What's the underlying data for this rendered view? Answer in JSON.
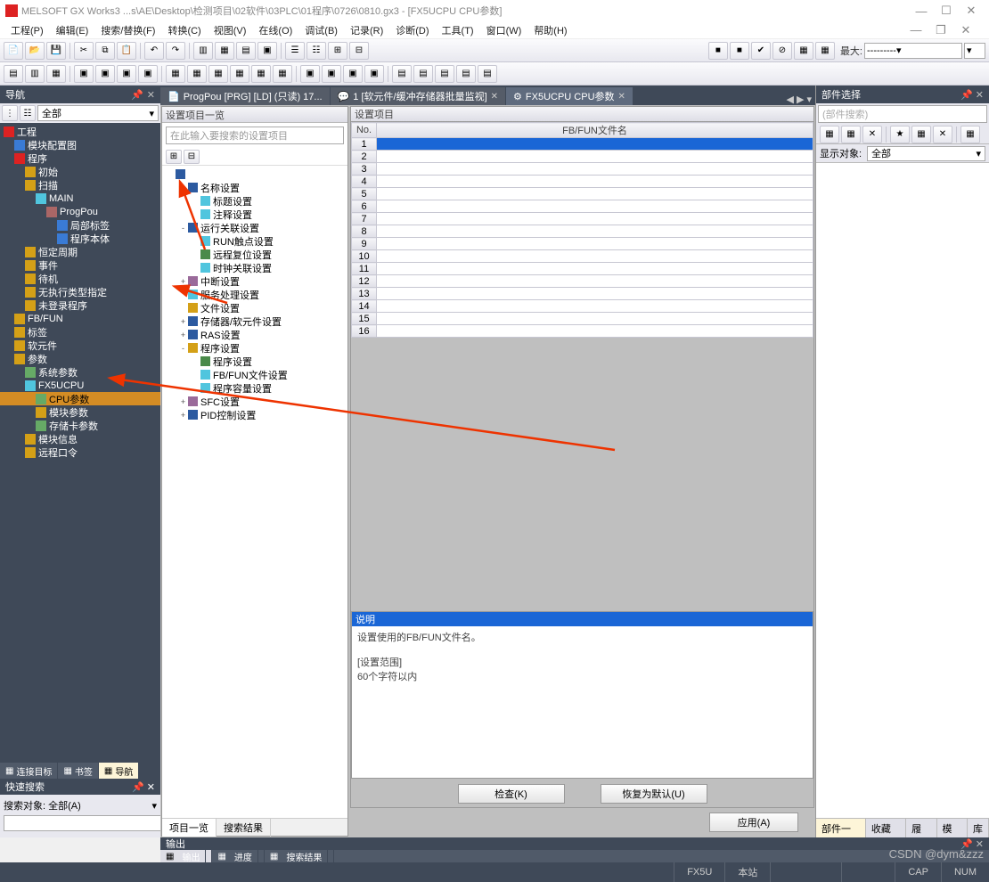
{
  "title": "MELSOFT GX Works3 ...s\\AE\\Desktop\\检测项目\\02软件\\03PLC\\01程序\\0726\\0810.gx3 - [FX5UCPU CPU参数]",
  "menu": [
    "工程(P)",
    "编辑(E)",
    "搜索/替换(F)",
    "转换(C)",
    "视图(V)",
    "在线(O)",
    "调试(B)",
    "记录(R)",
    "诊断(D)",
    "工具(T)",
    "窗口(W)",
    "帮助(H)"
  ],
  "tb2_label": "最大:",
  "tb2_combo": "---------",
  "left": {
    "title": "导航",
    "filter_label": "全部"
  },
  "nav_tree": [
    {
      "d": 0,
      "ic": "ico-red",
      "t": "工程"
    },
    {
      "d": 1,
      "ic": "ico-blue",
      "t": "模块配置图"
    },
    {
      "d": 1,
      "ic": "ico-red",
      "t": "程序"
    },
    {
      "d": 2,
      "ic": "ico-gold",
      "t": "初始"
    },
    {
      "d": 2,
      "ic": "ico-gold",
      "t": "扫描"
    },
    {
      "d": 3,
      "ic": "ico-cyan",
      "t": "MAIN"
    },
    {
      "d": 4,
      "ic": "ico-prog",
      "t": "ProgPou"
    },
    {
      "d": 5,
      "ic": "ico-blue",
      "t": "局部标签"
    },
    {
      "d": 5,
      "ic": "ico-blue",
      "t": "程序本体"
    },
    {
      "d": 2,
      "ic": "ico-gold",
      "t": "恒定周期"
    },
    {
      "d": 2,
      "ic": "ico-gold",
      "t": "事件"
    },
    {
      "d": 2,
      "ic": "ico-gold",
      "t": "待机"
    },
    {
      "d": 2,
      "ic": "ico-gold",
      "t": "无执行类型指定"
    },
    {
      "d": 2,
      "ic": "ico-gold",
      "t": "未登录程序"
    },
    {
      "d": 1,
      "ic": "ico-gold",
      "t": "FB/FUN"
    },
    {
      "d": 1,
      "ic": "ico-gold",
      "t": "标签"
    },
    {
      "d": 1,
      "ic": "ico-gold",
      "t": "软元件"
    },
    {
      "d": 1,
      "ic": "ico-gold",
      "t": "参数"
    },
    {
      "d": 2,
      "ic": "ico-green",
      "t": "系统参数"
    },
    {
      "d": 2,
      "ic": "ico-cyan",
      "t": "FX5UCPU"
    },
    {
      "d": 3,
      "ic": "ico-green",
      "t": "CPU参数",
      "sel": true
    },
    {
      "d": 3,
      "ic": "ico-gold",
      "t": "模块参数"
    },
    {
      "d": 3,
      "ic": "ico-green",
      "t": "存储卡参数"
    },
    {
      "d": 2,
      "ic": "ico-gold",
      "t": "模块信息"
    },
    {
      "d": 2,
      "ic": "ico-gold",
      "t": "远程口令"
    }
  ],
  "left_foot": [
    "连接目标",
    "书签",
    "导航"
  ],
  "quick": {
    "title": "快速搜索",
    "filter": "搜索对象: 全部(A)"
  },
  "doc_tabs": [
    {
      "label": "ProgPou [PRG] [LD] (只读) 17..."
    },
    {
      "label": "1 [软元件/缓冲存储器批量监视]"
    },
    {
      "label": "FX5UCPU CPU参数",
      "active": true
    }
  ],
  "setting": {
    "title_left": "设置项目一览",
    "title_right": "设置项目",
    "search_ph": "在此输入要搜索的设置项目",
    "tabs": [
      "项目一览",
      "搜索结果"
    ]
  },
  "stree": [
    {
      "d": 0,
      "tw": "",
      "ic": "si-b",
      "t": ""
    },
    {
      "d": 1,
      "tw": "-",
      "ic": "si-b",
      "t": "名称设置"
    },
    {
      "d": 2,
      "tw": "",
      "ic": "si-c",
      "t": "标题设置"
    },
    {
      "d": 2,
      "tw": "",
      "ic": "si-c",
      "t": "注释设置"
    },
    {
      "d": 1,
      "tw": "-",
      "ic": "si-b",
      "t": "运行关联设置"
    },
    {
      "d": 2,
      "tw": "",
      "ic": "si-c",
      "t": "RUN触点设置"
    },
    {
      "d": 2,
      "tw": "",
      "ic": "si-g",
      "t": "远程复位设置"
    },
    {
      "d": 2,
      "tw": "",
      "ic": "si-c",
      "t": "时钟关联设置"
    },
    {
      "d": 1,
      "tw": "+",
      "ic": "si-p",
      "t": "中断设置"
    },
    {
      "d": 1,
      "tw": "",
      "ic": "si-c",
      "t": "服务处理设置"
    },
    {
      "d": 1,
      "tw": "",
      "ic": "si-y",
      "t": "文件设置"
    },
    {
      "d": 1,
      "tw": "+",
      "ic": "si-b",
      "t": "存储器/软元件设置"
    },
    {
      "d": 1,
      "tw": "+",
      "ic": "si-b",
      "t": "RAS设置"
    },
    {
      "d": 1,
      "tw": "-",
      "ic": "si-y",
      "t": "程序设置"
    },
    {
      "d": 2,
      "tw": "",
      "ic": "si-g",
      "t": "程序设置"
    },
    {
      "d": 2,
      "tw": "",
      "ic": "si-c",
      "t": "FB/FUN文件设置"
    },
    {
      "d": 2,
      "tw": "",
      "ic": "si-c",
      "t": "程序容量设置"
    },
    {
      "d": 1,
      "tw": "+",
      "ic": "si-p",
      "t": "SFC设置"
    },
    {
      "d": 1,
      "tw": "+",
      "ic": "si-b",
      "t": "PID控制设置"
    }
  ],
  "grid": {
    "h_no": "No.",
    "h_name": "FB/FUN文件名",
    "rows": 16
  },
  "desc": {
    "hdr": "说明",
    "l1": "设置使用的FB/FUN文件名。",
    "l2": "[设置范围]",
    "l3": "60个字符以内"
  },
  "btn_check": "检查(K)",
  "btn_default": "恢复为默认(U)",
  "btn_apply": "应用(A)",
  "right": {
    "title": "部件选择",
    "search_ph": "(部件搜索)",
    "filter_label": "显示对象:",
    "filter_value": "全部",
    "tabs": [
      "部件一览",
      "收藏夹",
      "履历",
      "模块",
      "库"
    ]
  },
  "bottom": {
    "title": "输出",
    "tabs": [
      "输出",
      "进度",
      "搜索结果"
    ]
  },
  "status": {
    "cells": [
      "FX5U",
      "本站"
    ],
    "caps": "CAP",
    "num": "NUM"
  },
  "watermark": "CSDN @dym&zzz"
}
